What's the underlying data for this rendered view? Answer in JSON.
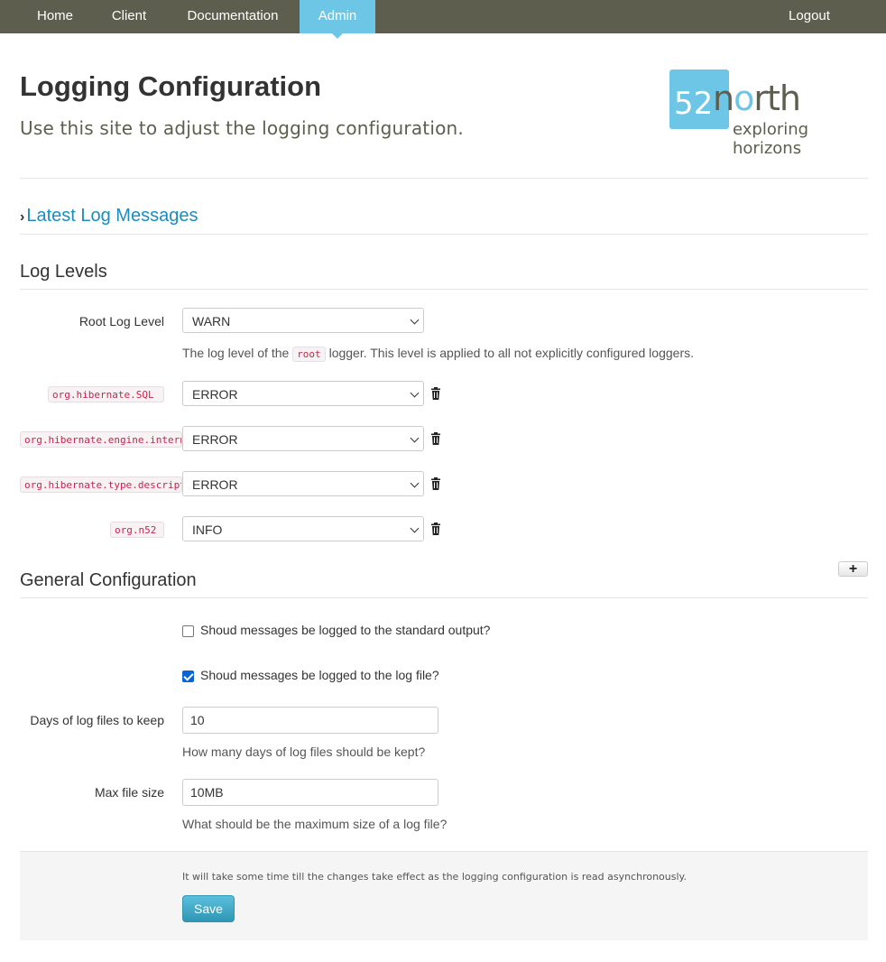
{
  "nav": {
    "items": [
      {
        "label": "Home"
      },
      {
        "label": "Client"
      },
      {
        "label": "Documentation"
      },
      {
        "label": "Admin",
        "active": true
      }
    ],
    "logout": "Logout"
  },
  "header": {
    "title": "Logging Configuration",
    "subtitle": "Use this site to adjust the logging configuration.",
    "logo": {
      "number": "52",
      "word_a": "n",
      "word_o": "o",
      "word_b": "rth",
      "tagline": "exploring horizons"
    }
  },
  "latest_log": {
    "label": "Latest Log Messages"
  },
  "log_levels": {
    "heading": "Log Levels",
    "root": {
      "label": "Root Log Level",
      "value": "WARN",
      "help_prefix": "The log level of the",
      "help_code": "root",
      "help_suffix": "logger. This level is applied to all not explicitly configured loggers."
    },
    "loggers": [
      {
        "name": "org.hibernate.SQL",
        "value": "ERROR"
      },
      {
        "name": "org.hibernate.engine.internal",
        "value": "ERROR"
      },
      {
        "name": "org.hibernate.type.descriptor",
        "value": "ERROR"
      },
      {
        "name": "org.n52",
        "value": "INFO"
      }
    ],
    "add_symbol": "+"
  },
  "general": {
    "heading": "General Configuration",
    "stdout": {
      "label": "Shoud messages be logged to the standard output?",
      "checked": false
    },
    "logfile": {
      "label": "Shoud messages be logged to the log file?",
      "checked": true
    },
    "days": {
      "label": "Days of log files to keep",
      "value": "10",
      "help": "How many days of log files should be kept?"
    },
    "maxsize": {
      "label": "Max file size",
      "value": "10MB",
      "help": "What should be the maximum size of a log file?"
    }
  },
  "footer": {
    "note": "It will take some time till the changes take effect as the logging configuration is read asynchronously.",
    "save": "Save"
  },
  "colors": {
    "navbar": "#5e5e4e",
    "accent": "#6ec6e6",
    "link": "#1a8cc0",
    "save": "#2f96b4"
  }
}
